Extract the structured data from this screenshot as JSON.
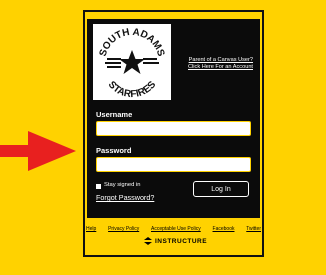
{
  "login": {
    "parent_link_line1": "Parent of a Canvas User?",
    "parent_link_line2": "Click Here For an Account",
    "username_label": "Username",
    "password_label": "Password",
    "stay_signed_in": "Stay signed in",
    "forgot_password": "Forgot Password?",
    "login_button": "Log In"
  },
  "logo": {
    "text_top": "SOUTH ADAMS",
    "text_bottom": "STARFIRES"
  },
  "footer": {
    "links": [
      "Help",
      "Privacy Policy",
      "Acceptable Use Policy",
      "Facebook",
      "Twitter"
    ],
    "brand": "INSTRUCTURE"
  },
  "colors": {
    "background": "#FFD200",
    "panel": "#0b0b0b",
    "arrow": "#E8201F"
  }
}
